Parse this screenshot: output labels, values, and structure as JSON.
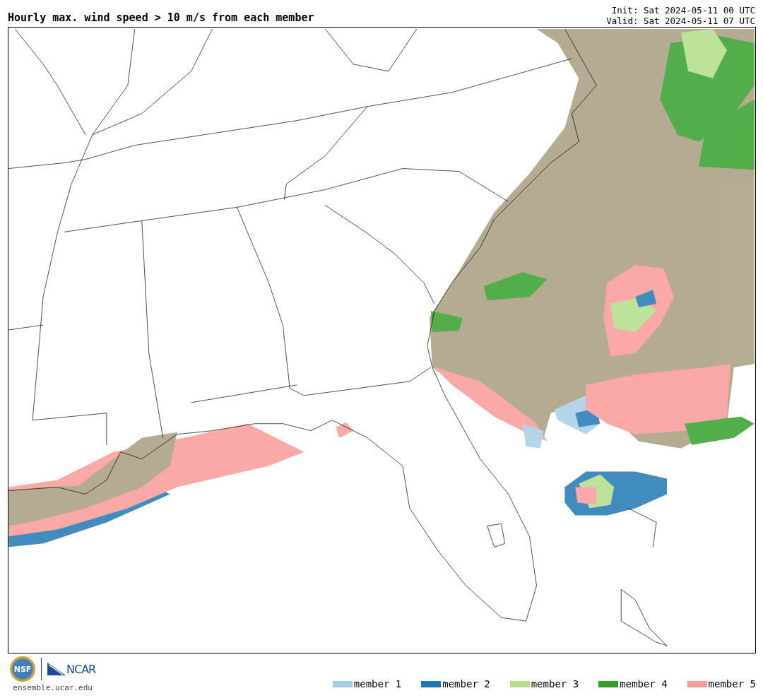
{
  "title": "Hourly max. wind speed > 10 m/s from each member",
  "init": "Init: Sat 2024-05-11 00 UTC",
  "valid": "Valid: Sat 2024-05-11 07 UTC",
  "logos": {
    "nsf": "NSF",
    "ncar": "NCAR"
  },
  "site": "ensemble.ucar.edu",
  "legend": [
    {
      "label": "member 1",
      "color": "#a6cee3"
    },
    {
      "label": "member 2",
      "color": "#1f78b4"
    },
    {
      "label": "member 3",
      "color": "#b2df8a"
    },
    {
      "label": "member 4",
      "color": "#33a02c"
    },
    {
      "label": "member 5",
      "color": "#fb9a99"
    }
  ]
}
